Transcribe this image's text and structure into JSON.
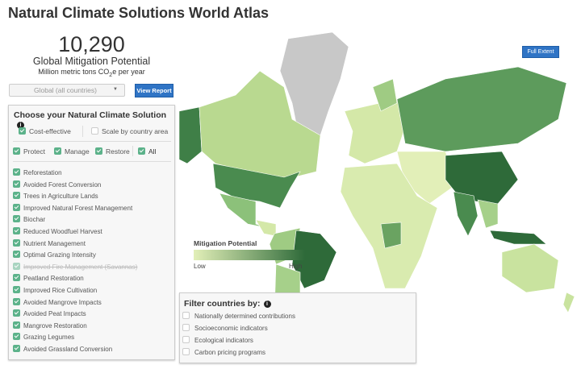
{
  "title": "Natural Climate Solutions World Atlas",
  "summary": {
    "value": "10,290",
    "label": "Global Mitigation Potential",
    "unit_pre": "Million metric tons CO",
    "unit_sub": "2",
    "unit_post": "e per year"
  },
  "region_select": {
    "value": "Global (all countries)"
  },
  "view_report_label": "View Report",
  "full_extent_label": "Full Extent",
  "panel": {
    "title": "Choose your Natural Climate Solution",
    "cost_effective": {
      "label": "Cost-effective",
      "checked": true
    },
    "scale_by_area": {
      "label": "Scale by country area",
      "checked": false
    },
    "categories": [
      {
        "label": "Protect",
        "checked": true
      },
      {
        "label": "Manage",
        "checked": true
      },
      {
        "label": "Restore",
        "checked": true
      },
      {
        "label": "All",
        "checked": true
      }
    ],
    "solutions": [
      {
        "label": "Reforestation",
        "checked": true,
        "disabled": false
      },
      {
        "label": "Avoided Forest Conversion",
        "checked": true,
        "disabled": false
      },
      {
        "label": "Trees in Agriculture Lands",
        "checked": true,
        "disabled": false
      },
      {
        "label": "Improved Natural Forest Management",
        "checked": true,
        "disabled": false
      },
      {
        "label": "Biochar",
        "checked": true,
        "disabled": false
      },
      {
        "label": "Reduced Woodfuel Harvest",
        "checked": true,
        "disabled": false
      },
      {
        "label": "Nutrient Management",
        "checked": true,
        "disabled": false
      },
      {
        "label": "Optimal Grazing Intensity",
        "checked": true,
        "disabled": false
      },
      {
        "label": "Improved Fire Management (Savannas)",
        "checked": true,
        "disabled": true
      },
      {
        "label": "Peatland Restoration",
        "checked": true,
        "disabled": false
      },
      {
        "label": "Improved Rice Cultivation",
        "checked": true,
        "disabled": false
      },
      {
        "label": "Avoided Mangrove Impacts",
        "checked": true,
        "disabled": false
      },
      {
        "label": "Avoided Peat Impacts",
        "checked": true,
        "disabled": false
      },
      {
        "label": "Mangrove Restoration",
        "checked": true,
        "disabled": false
      },
      {
        "label": "Grazing Legumes",
        "checked": true,
        "disabled": false
      },
      {
        "label": "Avoided Grassland Conversion",
        "checked": true,
        "disabled": false
      }
    ]
  },
  "legend": {
    "title": "Mitigation Potential",
    "low": "Low",
    "high": "High",
    "low_color": "#e2efb8",
    "high_color": "#2e6a39"
  },
  "filter": {
    "title": "Filter countries by:",
    "options": [
      {
        "label": "Nationally determined contributions",
        "checked": false
      },
      {
        "label": "Socioeconomic indicators",
        "checked": false
      },
      {
        "label": "Ecological indicators",
        "checked": false
      },
      {
        "label": "Carbon pricing programs",
        "checked": false
      }
    ]
  },
  "colors": {
    "accent": "#2f74c5",
    "check": "#5cb28a",
    "no_data": "#c8c8c8"
  }
}
